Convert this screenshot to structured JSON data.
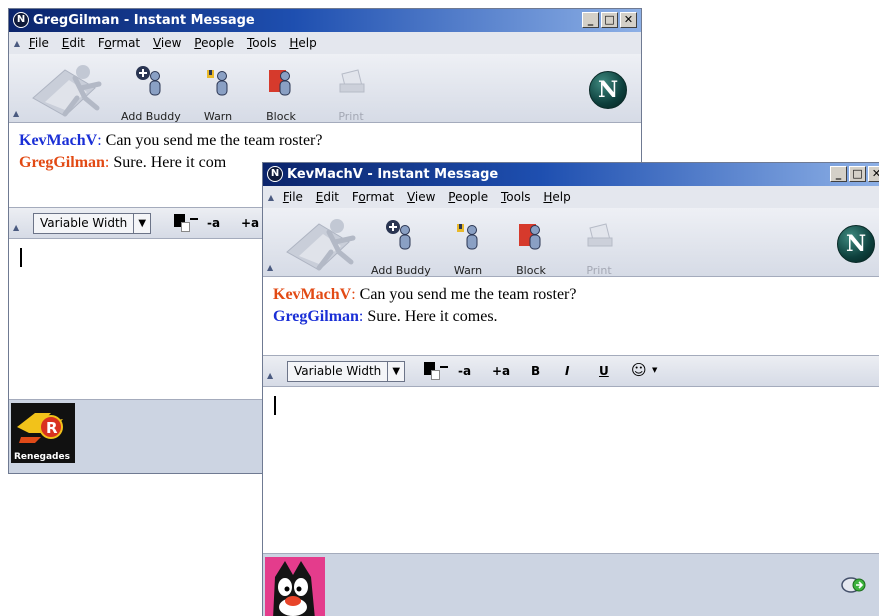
{
  "window_back": {
    "title": "GregGilman - Instant Message",
    "menu": [
      {
        "label": "File",
        "key": "F",
        "rest": "ile"
      },
      {
        "label": "Edit",
        "key": "E",
        "rest": "dit"
      },
      {
        "label": "Format",
        "pre": "F",
        "key": "o",
        "rest": "rmat"
      },
      {
        "label": "View",
        "key": "V",
        "rest": "iew"
      },
      {
        "label": "People",
        "key": "P",
        "rest": "eople"
      },
      {
        "label": "Tools",
        "key": "T",
        "rest": "ools"
      },
      {
        "label": "Help",
        "key": "H",
        "rest": "elp"
      }
    ],
    "toolbar": {
      "add_buddy": "Add Buddy",
      "warn": "Warn",
      "block": "Block",
      "print": "Print"
    },
    "messages": [
      {
        "sender": "KevMachV",
        "sep": ":",
        "text": " Can you send me the team roster?",
        "color": "#1a2fd6"
      },
      {
        "sender": "GregGilman",
        "sep": ":",
        "text": " Sure. Here it com",
        "color": "#e24a14"
      }
    ],
    "format_bar": {
      "font": "Variable Width",
      "smaller": "-a",
      "larger": "+a"
    },
    "buddy_icon": {
      "name": "renegades-logo",
      "caption": "Renegades"
    }
  },
  "window_front": {
    "title": "KevMachV - Instant Message",
    "menu": [
      {
        "label": "File",
        "key": "F",
        "rest": "ile"
      },
      {
        "label": "Edit",
        "key": "E",
        "rest": "dit"
      },
      {
        "label": "Format",
        "pre": "F",
        "key": "o",
        "rest": "rmat"
      },
      {
        "label": "View",
        "key": "V",
        "rest": "iew"
      },
      {
        "label": "People",
        "key": "P",
        "rest": "eople"
      },
      {
        "label": "Tools",
        "key": "T",
        "rest": "ools"
      },
      {
        "label": "Help",
        "key": "H",
        "rest": "elp"
      }
    ],
    "toolbar": {
      "add_buddy": "Add Buddy",
      "warn": "Warn",
      "block": "Block",
      "print": "Print"
    },
    "messages": [
      {
        "sender": "KevMachV",
        "sep": ":",
        "text": " Can you send me the team roster?",
        "color": "#e24a14"
      },
      {
        "sender": "GregGilman",
        "sep": ":",
        "text": " Sure. Here it comes.",
        "color": "#1a2fd6"
      }
    ],
    "format_bar": {
      "font": "Variable Width",
      "smaller": "-a",
      "larger": "+a",
      "bold": "B",
      "italic": "I",
      "underline": "U",
      "smiley": "☺"
    },
    "buddy_icon": {
      "name": "cartoon-cat-avatar"
    }
  },
  "colors": {
    "title_dark": "#0b246b",
    "title_light": "#8db0e6",
    "chrome": "#d8dce6",
    "status": "#ccd4e2"
  }
}
